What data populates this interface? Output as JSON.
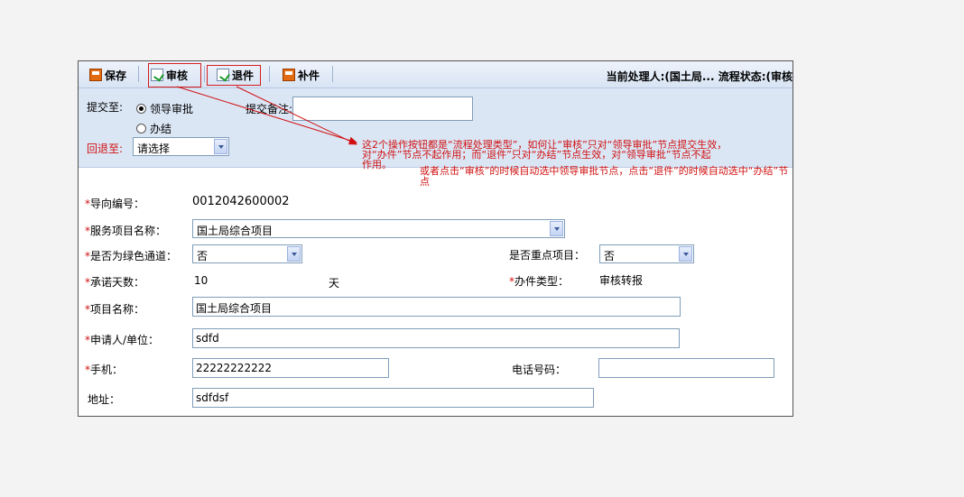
{
  "toolbar": {
    "save_label": "保存",
    "audit_label": "审核",
    "return_label": "退件",
    "supplement_label": "补件",
    "status_text": "当前处理人:(国土局...   流程状态:(审核"
  },
  "submit_panel": {
    "submit_to_label": "提交至:",
    "option_leader": "领导审批",
    "option_finish": "办结",
    "remark_label": "提交备注:",
    "remark_value": "",
    "return_to_label": "回退至:",
    "return_to_value": "请选择"
  },
  "annotation": {
    "line1": "这2个操作按钮都是“流程处理类型”，如何让“审核”只对“领导审批”节点提交生效，",
    "line2": "对“办件”节点不起作用；而“退件”只对“办结”节点生效，对“领导审批”节点不起",
    "line3": "作用。",
    "line4": "或者点击“审核”的时候自动选中领导审批节点，点击“退件”的时候自动选中“办结”节点",
    "color": "#d01010"
  },
  "form": {
    "guide_no_label": "导向编号：",
    "guide_no_value": "0012042600002",
    "service_label": "服务项目名称：",
    "service_value": "国土局综合项目",
    "green_label": "是否为绿色通道：",
    "green_value": "否",
    "key_label": "是否重点项目：",
    "key_value": "否",
    "days_label": "承诺天数：",
    "days_value": "10",
    "days_unit": "天",
    "type_label": "办件类型：",
    "type_value": "审核转报",
    "project_label": "项目名称：",
    "project_value": "国土局综合项目",
    "applicant_label": "申请人/单位：",
    "applicant_value": "sdfd",
    "mobile_label": "手机：",
    "mobile_value": "22222222222",
    "phone_label": "电话号码：",
    "phone_value": "",
    "address_label": "地址：",
    "address_value": "sdfdsf"
  },
  "required_mark": "*"
}
